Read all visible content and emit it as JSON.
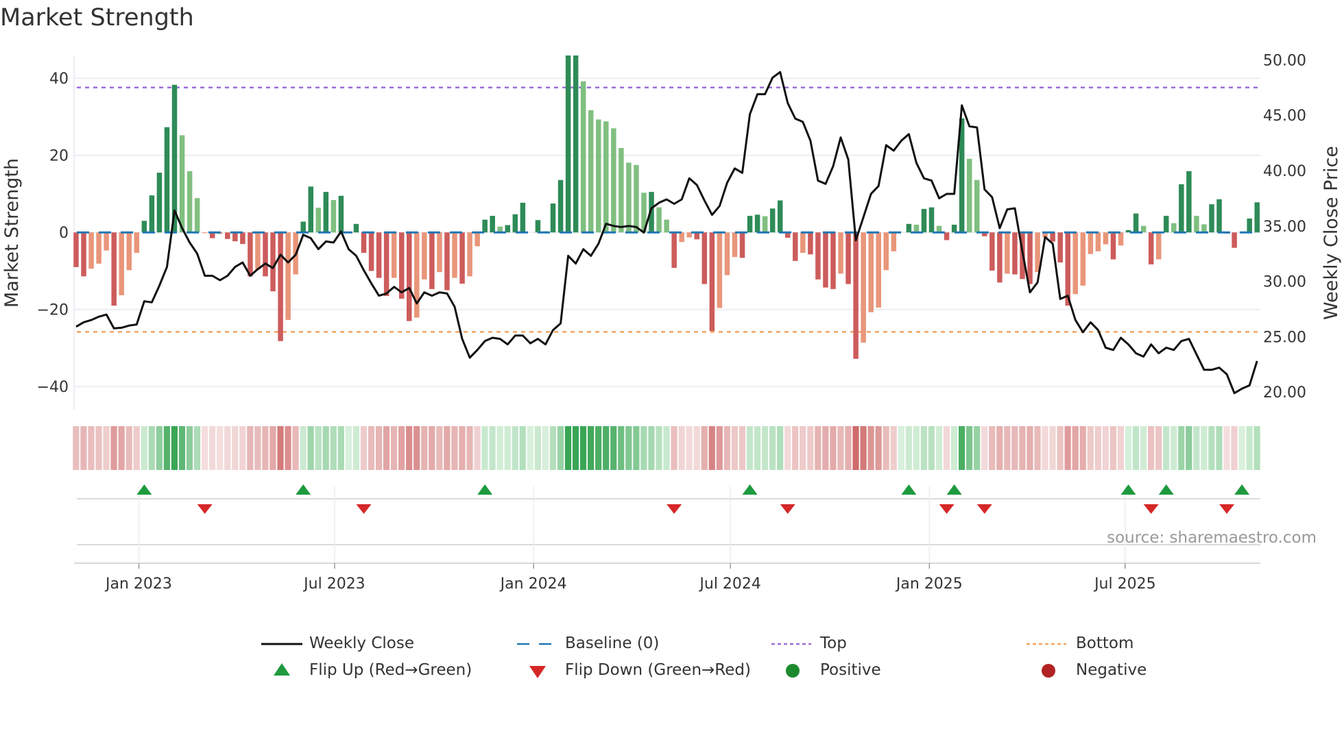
{
  "title": "Market Strength",
  "source": "source: sharemaestro.com",
  "colors": {
    "strong_pos": "#2e8b57",
    "weak_pos": "#80bf80",
    "strong_neg": "#cd5c5c",
    "weak_neg": "#e9967a",
    "line": "#111111",
    "baseline": "#1f77b4",
    "top": "#9b6fd6",
    "bottom": "#f4a460",
    "flip_up": "#1e9a3e",
    "flip_down": "#d62728",
    "positive": "#1e8a2e",
    "negative": "#b22222"
  },
  "legend": {
    "weekly_close": "Weekly Close",
    "baseline": "Baseline (0)",
    "top": "Top",
    "bottom": "Bottom",
    "flip_up": "Flip Up (Red→Green)",
    "flip_down": "Flip Down (Green→Red)",
    "positive": "Positive",
    "negative": "Negative"
  },
  "chart_data": {
    "type": "bar",
    "title": "Market Strength",
    "ylabel": "Market Strength",
    "y2label": "Weekly Close Price",
    "ylim": [
      -46,
      45.9
    ],
    "y2lim": [
      18.4,
      50.4
    ],
    "start_week": "2022-11-04",
    "freq_days": 7,
    "yticks": [
      "40",
      "20",
      "0",
      "−20",
      "−40"
    ],
    "ytick_values": [
      40,
      20,
      0,
      -20,
      -40
    ],
    "y2ticks": [
      "50.00",
      "45.00",
      "40.00",
      "35.00",
      "30.00",
      "25.00",
      "20.00"
    ],
    "y2tick_values": [
      50,
      45,
      40,
      35,
      30,
      25,
      20
    ],
    "xticks": [
      "Jan 2023",
      "Jul 2023",
      "Jan 2024",
      "Jul 2024",
      "Jan 2025",
      "Jul 2025"
    ],
    "xtick_dates": [
      "2023-01-01",
      "2023-07-01",
      "2024-01-01",
      "2024-07-01",
      "2025-01-01",
      "2025-07-01"
    ],
    "top_level": 37.6,
    "bottom_level": -25.8,
    "baseline": 0,
    "strength": [
      -9,
      -11.4,
      -9.4,
      -8.1,
      -4.7,
      -19,
      -16.3,
      -9.8,
      -5.3,
      3,
      9.6,
      15.5,
      27.3,
      38.3,
      25.2,
      15.9,
      8.9,
      -0.2,
      -1.5,
      -0.4,
      -1.7,
      -2.3,
      -3,
      -11.4,
      -9.6,
      -11.4,
      -15.3,
      -28.2,
      -22.7,
      -10.9,
      2.8,
      11.9,
      6.4,
      10.5,
      8.4,
      9.5,
      0,
      2.2,
      -5.3,
      -10,
      -11.8,
      -16.5,
      -11.8,
      -17.2,
      -23,
      -22.1,
      -12.2,
      -14.7,
      -10.3,
      -15,
      -11.8,
      -13.3,
      -11.4,
      -3.6,
      3.3,
      4.3,
      1.5,
      1.9,
      4.7,
      7.7,
      0,
      3.2,
      0.3,
      7.5,
      13.6,
      46,
      46,
      39.2,
      31.7,
      29.3,
      28.8,
      27,
      21.9,
      18.1,
      17.5,
      10.3,
      10.5,
      6.5,
      3.3,
      -9.2,
      -2.5,
      -1.3,
      -1.8,
      -13.4,
      -25.6,
      -19.6,
      -11.1,
      -6.4,
      -6.6,
      4.3,
      4.6,
      4.2,
      6.2,
      8.3,
      -1.4,
      -7.4,
      -5.3,
      -5.7,
      -12.2,
      -14.3,
      -14.7,
      -10.7,
      -13.4,
      -32.8,
      -28.6,
      -20.7,
      -19.5,
      -9.8,
      -4.9,
      0,
      2.2,
      2,
      6.1,
      6.5,
      1.7,
      -2,
      2,
      29.6,
      19.1,
      13.6,
      -1,
      -9.9,
      -13,
      -10.7,
      -10.9,
      -12.1,
      -13.4,
      -10.3,
      -1.3,
      -2.4,
      -7.8,
      -19,
      -16,
      -13.8,
      -5.6,
      -4.9,
      -3.1,
      -7,
      -3.4,
      0.6,
      4.9,
      1.7,
      -8.3,
      -7,
      4.3,
      2.4,
      12.5,
      15.9,
      4.3,
      2.1,
      7.3,
      8.6,
      -0.3,
      -4,
      0.1,
      3.6,
      7.8
    ],
    "strong": [
      1,
      1,
      0,
      0,
      0,
      1,
      0,
      0,
      0,
      1,
      1,
      1,
      1,
      1,
      0,
      0,
      0,
      0,
      1,
      0,
      1,
      1,
      1,
      1,
      0,
      1,
      1,
      1,
      0,
      0,
      1,
      1,
      0,
      1,
      0,
      1,
      0,
      1,
      1,
      1,
      1,
      1,
      0,
      1,
      1,
      0,
      0,
      1,
      0,
      1,
      0,
      1,
      0,
      0,
      1,
      1,
      0,
      1,
      1,
      1,
      0,
      1,
      0,
      1,
      1,
      1,
      1,
      0,
      0,
      0,
      0,
      0,
      0,
      0,
      0,
      0,
      1,
      0,
      0,
      1,
      0,
      0,
      1,
      1,
      1,
      0,
      0,
      0,
      1,
      1,
      1,
      0,
      1,
      1,
      1,
      1,
      0,
      1,
      1,
      1,
      1,
      0,
      1,
      1,
      0,
      0,
      0,
      0,
      0,
      0,
      1,
      0,
      1,
      1,
      0,
      1,
      1,
      1,
      0,
      0,
      1,
      1,
      1,
      0,
      1,
      1,
      1,
      0,
      0,
      1,
      1,
      1,
      0,
      0,
      0,
      0,
      0,
      1,
      0,
      1,
      1,
      0,
      1,
      0,
      1,
      0,
      1,
      1,
      0,
      0,
      1,
      1,
      1,
      1,
      0,
      1,
      1
    ],
    "weekly_close": [
      25.9,
      26.3,
      26.5,
      26.8,
      27.0,
      25.75,
      25.8,
      26.0,
      26.1,
      28.2,
      28.1,
      29.6,
      31.3,
      36.4,
      34.8,
      33.5,
      32.5,
      30.5,
      30.5,
      30.1,
      30.5,
      31.3,
      31.7,
      30.5,
      31.1,
      31.6,
      31.2,
      32.4,
      31.7,
      32.4,
      34.2,
      33.9,
      32.9,
      33.6,
      33.5,
      34.5,
      32.9,
      32.3,
      31.0,
      29.8,
      28.7,
      28.9,
      29.5,
      29.0,
      29.4,
      28.0,
      29.0,
      28.7,
      29.0,
      28.9,
      27.7,
      24.8,
      23.1,
      23.8,
      24.6,
      24.9,
      24.8,
      24.3,
      25.1,
      25.1,
      24.4,
      24.8,
      24.3,
      25.6,
      26.2,
      32.3,
      31.6,
      32.9,
      32.3,
      33.4,
      35.2,
      35.0,
      34.9,
      35.0,
      34.9,
      34.4,
      36.6,
      37.1,
      37.4,
      37.0,
      37.4,
      39.3,
      38.7,
      37.3,
      36.0,
      36.8,
      38.9,
      40.2,
      39.8,
      45.1,
      46.9,
      46.9,
      48.4,
      48.9,
      46.1,
      44.7,
      44.4,
      42.7,
      39.1,
      38.8,
      40.4,
      43.0,
      41.0,
      33.7,
      35.8,
      37.9,
      38.6,
      42.3,
      41.8,
      42.7,
      43.3,
      40.7,
      39.3,
      39.1,
      37.5,
      37.9,
      37.9,
      45.9,
      44.0,
      43.9,
      38.3,
      37.6,
      34.8,
      36.5,
      36.6,
      32.7,
      29.0,
      29.9,
      34.0,
      33.4,
      28.4,
      28.7,
      26.5,
      25.4,
      26.3,
      25.6,
      24.0,
      23.8,
      24.9,
      24.3,
      23.5,
      23.2,
      24.3,
      23.5,
      24.0,
      23.8,
      24.6,
      24.8,
      23.4,
      22.0,
      22.0,
      22.2,
      21.6,
      19.9,
      20.3,
      20.6,
      22.8
    ],
    "flip_up_weeks": [
      9,
      30,
      54,
      89,
      110,
      116,
      139,
      144,
      154
    ],
    "flip_down_weeks": [
      17,
      38,
      79,
      94,
      115,
      120,
      142,
      152
    ],
    "grid": true,
    "legend_position": "bottom"
  }
}
